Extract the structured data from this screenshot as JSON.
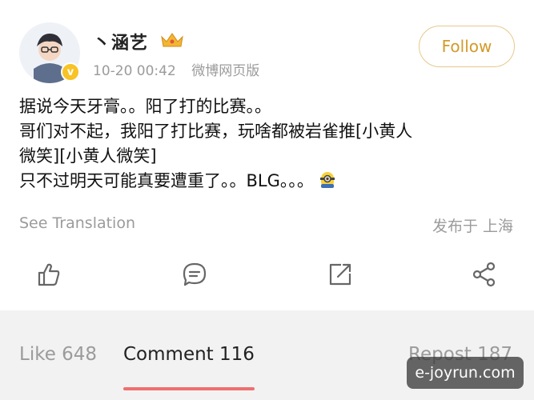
{
  "post": {
    "username": "丶涵艺",
    "timestamp": "10-20 00:42",
    "source": "微博网页版",
    "follow_label": "Follow",
    "lines": [
      "据说今天牙膏。。阳了打的比赛。。",
      "哥们对不起，我阳了打比赛，玩啥都被岩雀推[小黄人",
      "微笑][小黄人微笑]",
      "只不过明天可能真要遭重了。。BLG。。。"
    ],
    "translate_label": "See Translation",
    "location": "发布于 上海"
  },
  "actions": [
    {
      "icon": "like-icon"
    },
    {
      "icon": "comment-icon"
    },
    {
      "icon": "repost-icon"
    },
    {
      "icon": "share-icon"
    }
  ],
  "tabs": {
    "like": "Like 648",
    "comment": "Comment 116",
    "repost": "Repost 187"
  },
  "watermark": "e-joyrun.com",
  "colors": {
    "accent_gold": "#d39a2a",
    "tab_underline": "#ef6f6f",
    "muted": "#9b9b9b"
  }
}
